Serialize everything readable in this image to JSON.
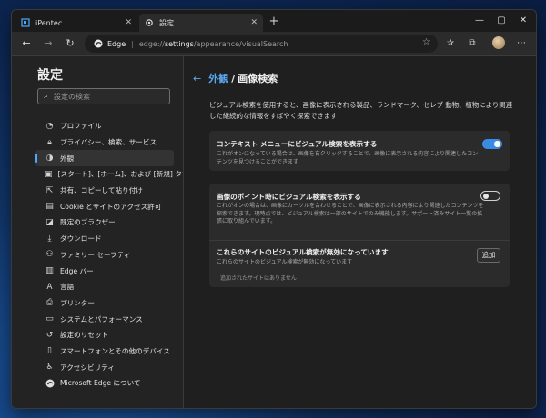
{
  "tabs": [
    {
      "label": "iPentec",
      "active": false
    },
    {
      "label": "設定",
      "active": true
    }
  ],
  "address": {
    "site": "Edge",
    "url_prefix": "edge://",
    "url_host": "settings",
    "url_path": "/appearance/visualSearch"
  },
  "sidebar": {
    "title": "設定",
    "search_placeholder": "設定の検索",
    "items": [
      {
        "label": "プロファイル",
        "icon": "profile-icon"
      },
      {
        "label": "プライバシー、検索、サービス",
        "icon": "lock-icon"
      },
      {
        "label": "外観",
        "icon": "appearance-icon",
        "active": true
      },
      {
        "label": "[スタート]、[ホーム]、および [新規] タブ",
        "icon": "home-tabs-icon"
      },
      {
        "label": "共有、コピーして貼り付け",
        "icon": "share-icon"
      },
      {
        "label": "Cookie とサイトのアクセス許可",
        "icon": "cookie-icon"
      },
      {
        "label": "既定のブラウザー",
        "icon": "browser-icon"
      },
      {
        "label": "ダウンロード",
        "icon": "download-icon"
      },
      {
        "label": "ファミリー セーフティ",
        "icon": "family-icon"
      },
      {
        "label": "Edge バー",
        "icon": "edge-bar-icon"
      },
      {
        "label": "言語",
        "icon": "language-icon"
      },
      {
        "label": "プリンター",
        "icon": "printer-icon"
      },
      {
        "label": "システムとパフォーマンス",
        "icon": "system-icon"
      },
      {
        "label": "設定のリセット",
        "icon": "reset-icon"
      },
      {
        "label": "スマートフォンとその他のデバイス",
        "icon": "phone-icon"
      },
      {
        "label": "アクセシビリティ",
        "icon": "accessibility-icon"
      },
      {
        "label": "Microsoft Edge について",
        "icon": "edge-logo-icon"
      }
    ]
  },
  "main": {
    "breadcrumb_parent": "外観",
    "breadcrumb_separator": "/",
    "breadcrumb_current": "画像検索",
    "description": "ビジュアル検索を使用すると、画像に表示される製品、ランドマーク、セレブ 動物、植物により関連した継続的な情報をすばやく探索できます",
    "context_menu": {
      "title": "コンテキスト メニューにビジュアル検索を表示する",
      "subtitle": "これがオンになっている場合は、画像を右クリックすることで、画像に表示される内容により関連したコンテンツを見つけることができます",
      "enabled": true
    },
    "hover": {
      "title": "画像のポイント時にビジュアル検索を表示する",
      "subtitle": "これがオンの場合は、画像にカーソルを合わせることで、画像に表示される内容により関連したコンテンツを探索できます。現時点では、ビジュアル検索は一部のサイトでのみ機能します。サポート済みサイト一覧の拡張に取り組んでいます。",
      "enabled": false
    },
    "disabled_sites": {
      "title": "これらのサイトのビジュアル検索が無効になっています",
      "subtitle": "これらのサイトのビジュアル検索が無効になっています",
      "add_label": "追加",
      "empty_text": "追加されたサイトはありません"
    }
  },
  "colors": {
    "accent": "#3b8be6",
    "link": "#5aa9f0"
  }
}
